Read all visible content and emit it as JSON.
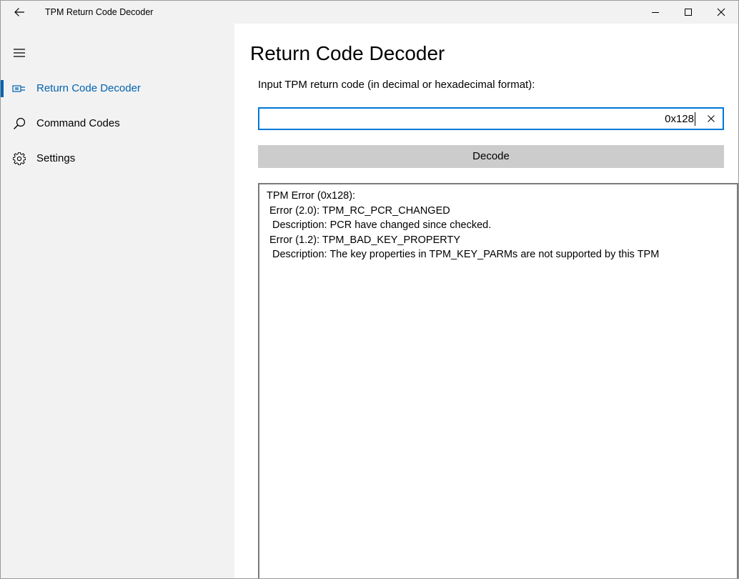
{
  "window": {
    "title": "TPM Return Code Decoder",
    "controls": [
      "minimize-icon",
      "maximize-icon",
      "close-icon"
    ]
  },
  "sidebar": {
    "items": [
      {
        "label": "Return Code Decoder",
        "icon": "decoder-icon",
        "selected": true
      },
      {
        "label": "Command Codes",
        "icon": "search-icon",
        "selected": false
      },
      {
        "label": "Settings",
        "icon": "gear-icon",
        "selected": false
      }
    ]
  },
  "main": {
    "title": "Return Code Decoder",
    "input_label": "Input TPM return code (in decimal or hexadecimal format):",
    "input_value": "0x128",
    "decode_label": "Decode",
    "output_lines": [
      "TPM Error (0x128):",
      "Error (2.0): TPM_RC_PCR_CHANGED",
      "Description: PCR have changed since checked.",
      "Error (1.2): TPM_BAD_KEY_PROPERTY",
      "Description: The key properties in TPM_KEY_PARMs are not supported by this TPM"
    ]
  },
  "colors": {
    "accent": "#0063b1",
    "focus_border": "#0078d7",
    "pane_background": "#f2f2f2",
    "button_background": "#cccccc"
  }
}
